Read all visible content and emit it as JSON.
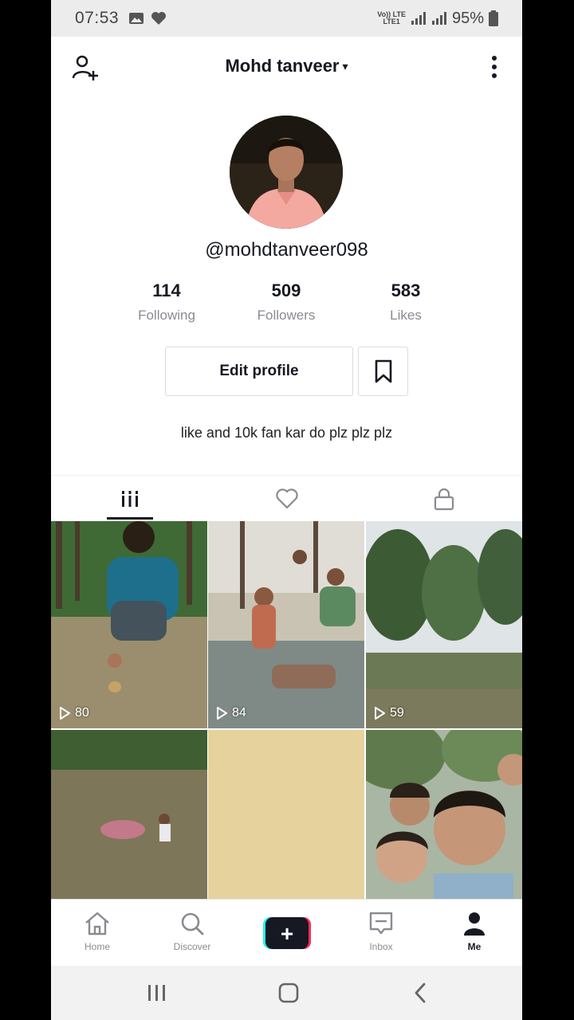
{
  "status_bar": {
    "time": "07:53",
    "network_top": "Vo)) LTE",
    "network_bottom": "LTE1",
    "battery": "95%"
  },
  "header": {
    "title": "Mohd tanveer",
    "caret": "▾"
  },
  "profile": {
    "handle": "@mohdtanveer098",
    "stats": [
      {
        "value": "114",
        "label": "Following"
      },
      {
        "value": "509",
        "label": "Followers"
      },
      {
        "value": "583",
        "label": "Likes"
      }
    ],
    "edit_label": "Edit profile",
    "bio": "like and 10k fan kar do plz plz plz"
  },
  "tabs": {
    "items": [
      {
        "icon": "videos-grid-icon"
      },
      {
        "icon": "heart-icon"
      },
      {
        "icon": "lock-icon"
      }
    ],
    "active": 0
  },
  "videos": [
    {
      "views": "80"
    },
    {
      "views": "84"
    },
    {
      "views": "59"
    },
    {
      "views": ""
    },
    {
      "views": ""
    },
    {
      "views": ""
    }
  ],
  "bottom_nav": {
    "home": "Home",
    "discover": "Discover",
    "create": "+",
    "inbox": "Inbox",
    "me": "Me"
  },
  "colors": {
    "accent_cyan": "#25f4ee",
    "accent_red": "#fe2c55",
    "text_dark": "#161823",
    "text_muted": "#8a8b91"
  }
}
